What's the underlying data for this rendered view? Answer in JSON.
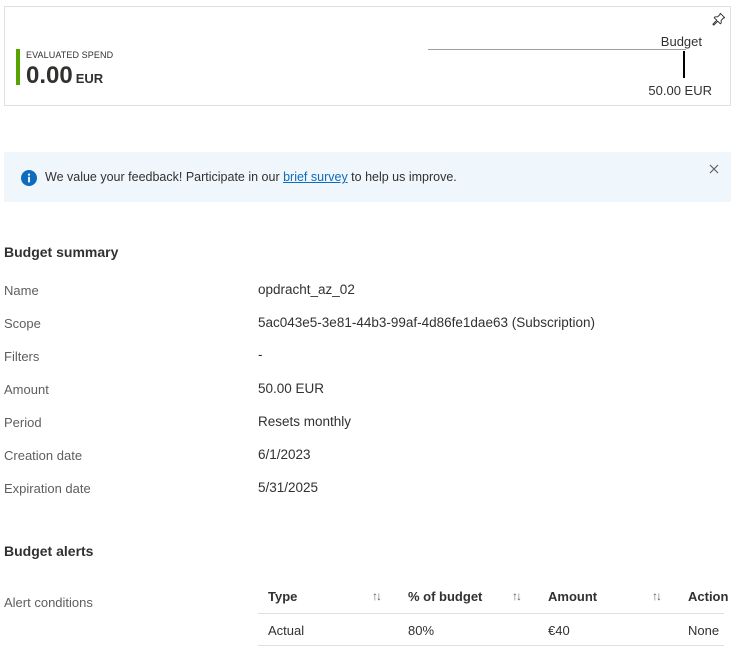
{
  "spend_card": {
    "label": "EVALUATED SPEND",
    "amount": "0.00",
    "currency": "EUR",
    "budget_label": "Budget",
    "budget_value": "50.00 EUR",
    "accent_color": "#57a300",
    "pin_icon": "pin-icon"
  },
  "banner": {
    "text_before": "We value your feedback! Participate in our ",
    "link": "brief survey",
    "text_after": " to help us improve.",
    "info_icon": "info-icon",
    "close_icon": "close-icon"
  },
  "summary": {
    "title": "Budget summary",
    "rows": [
      {
        "label": "Name",
        "value": "opdracht_az_02"
      },
      {
        "label": "Scope",
        "value": "5ac043e5-3e81-44b3-99af-4d86fe1dae63 (Subscription)"
      },
      {
        "label": "Filters",
        "value": "-"
      },
      {
        "label": "Amount",
        "value": "50.00 EUR"
      },
      {
        "label": "Period",
        "value": "Resets monthly"
      },
      {
        "label": "Creation date",
        "value": "6/1/2023"
      },
      {
        "label": "Expiration date",
        "value": "5/31/2025"
      }
    ]
  },
  "alerts": {
    "title": "Budget alerts",
    "label": "Alert conditions",
    "columns": [
      "Type",
      "% of budget",
      "Amount",
      "Action"
    ],
    "sort_glyph": "↑↓",
    "rows": [
      {
        "type": "Actual",
        "percent": "80%",
        "amount": "€40",
        "action": "None"
      }
    ]
  }
}
